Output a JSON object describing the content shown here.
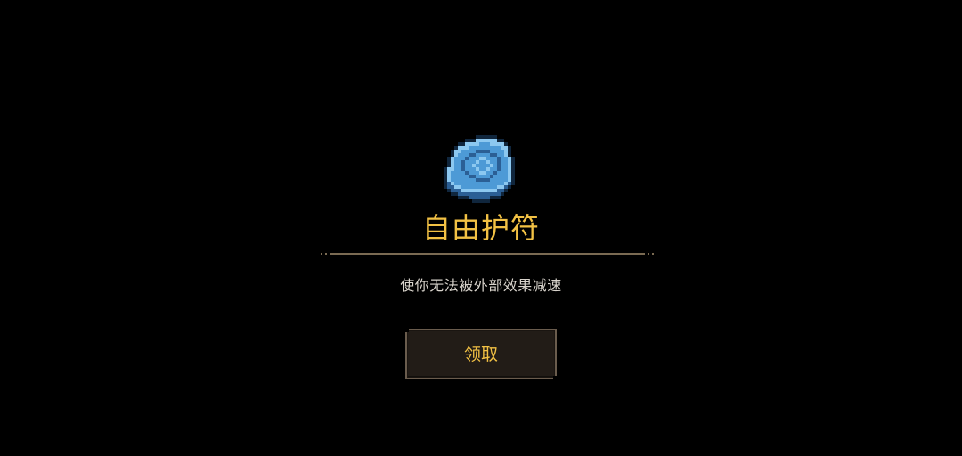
{
  "colors": {
    "background": "#000000",
    "title": "#f2c144",
    "description": "#d9d4cc",
    "divider": "#7a6a52",
    "button_text": "#f2c144",
    "button_bg": "#221c17",
    "button_border": "#6a5c4d",
    "icon_main": "#4d9ad6",
    "icon_light": "#8cc8f0",
    "icon_dark": "#2b5f95"
  },
  "reward": {
    "icon": "freedom-amulet-icon",
    "name": "自由护符",
    "description": "使你无法被外部效果减速"
  },
  "actions": {
    "claim_label": "领取"
  }
}
